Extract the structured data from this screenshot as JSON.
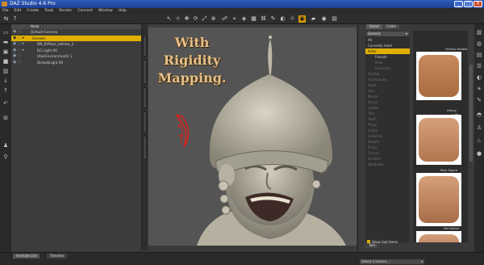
{
  "window": {
    "title": "DAZ Studio 4.6 Pro"
  },
  "menu": [
    "File",
    "Edit",
    "Create",
    "Tools",
    "Render",
    "Connect",
    "Window",
    "Help"
  ],
  "scene": {
    "header": "Node",
    "items": [
      {
        "label": "Default Camera",
        "selected": false
      },
      {
        "label": "Genesis",
        "selected": true
      },
      {
        "label": "BM_EVPack_helmet_2",
        "selected": false
      },
      {
        "label": "DG Light 00",
        "selected": false
      },
      {
        "label": "UberEnvironment2 1",
        "selected": false
      },
      {
        "label": "DistantLight 00",
        "selected": false
      }
    ]
  },
  "viewport": {
    "caption_lines": [
      "With",
      "Rigidity",
      "Mapping."
    ]
  },
  "library": {
    "tabs": [
      "Smart",
      "Folder"
    ],
    "dropdown": "Genesis",
    "items": [
      {
        "label": "All",
        "style": "normal"
      },
      {
        "label": "Currently Used",
        "style": "normal"
      },
      {
        "label": "Actor",
        "style": "selected"
      },
      {
        "label": "Female",
        "style": "sub"
      },
      {
        "label": "Male",
        "style": "subdim"
      },
      {
        "label": "Universal",
        "style": "subdim"
      },
      {
        "label": "Genital",
        "style": "dim"
      },
      {
        "label": "Accessories",
        "style": "dim"
      },
      {
        "label": "Head",
        "style": "dim"
      },
      {
        "label": "Hair",
        "style": "dim"
      },
      {
        "label": "Mouth",
        "style": "dim"
      },
      {
        "label": "Brows",
        "style": "dim"
      },
      {
        "label": "Lashes",
        "style": "dim"
      },
      {
        "label": "Tear",
        "style": "dim"
      },
      {
        "label": "Teeth",
        "style": "dim"
      },
      {
        "label": "Props",
        "style": "dim"
      },
      {
        "label": "Lights",
        "style": "dim"
      },
      {
        "label": "Cameras",
        "style": "dim"
      },
      {
        "label": "Morphs",
        "style": "dim"
      },
      {
        "label": "Poses",
        "style": "dim"
      },
      {
        "label": "Scenes",
        "style": "dim"
      },
      {
        "label": "Shaders",
        "style": "dim"
      },
      {
        "label": "Wardrobe",
        "style": "dim"
      }
    ],
    "show_sub_items": "Show Sub Items"
  },
  "thumbnails": [
    {
      "label": "Fitness Details",
      "value": ""
    },
    {
      "label": "Heavy",
      "value": "1.00"
    },
    {
      "label": "Pear Figure",
      "value": ""
    },
    {
      "label": "Pot Belied",
      "value": ""
    }
  ],
  "bottom": {
    "tabs": [
      "Animate Lite",
      "Timeline"
    ],
    "lesson": "Select a Lesson...",
    "text_tab": "Text"
  },
  "colors": {
    "accent": "#e0b000",
    "bg": "#3a3a3a"
  }
}
